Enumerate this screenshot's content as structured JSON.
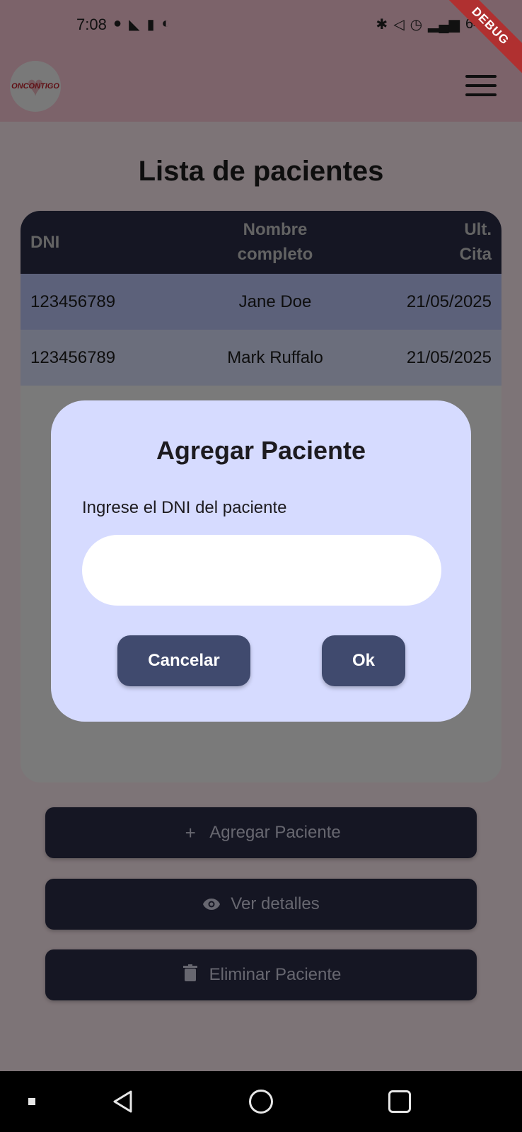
{
  "status_bar": {
    "time": "7:08",
    "battery": "64%"
  },
  "debug_ribbon": "DEBUG",
  "app": {
    "logo_text": "ONCONTIGO"
  },
  "page": {
    "title": "Lista de pacientes"
  },
  "table": {
    "headers": {
      "dni": "DNI",
      "name_line1": "Nombre",
      "name_line2": "completo",
      "cita_line1": "Ult.",
      "cita_line2": "Cita"
    },
    "rows": [
      {
        "dni": "123456789",
        "name": "Jane Doe",
        "cita": "21/05/2025"
      },
      {
        "dni": "123456789",
        "name": "Mark Ruffalo",
        "cita": "21/05/2025"
      }
    ]
  },
  "actions": {
    "add": {
      "label": "Agregar Paciente",
      "icon": "+"
    },
    "view": {
      "label": "Ver detalles",
      "icon": "eye-icon"
    },
    "delete": {
      "label": "Eliminar Paciente",
      "icon": "trash-icon"
    }
  },
  "dialog": {
    "title": "Agregar Paciente",
    "label": "Ingrese el DNI del paciente",
    "input_value": "",
    "cancel_label": "Cancelar",
    "ok_label": "Ok"
  }
}
